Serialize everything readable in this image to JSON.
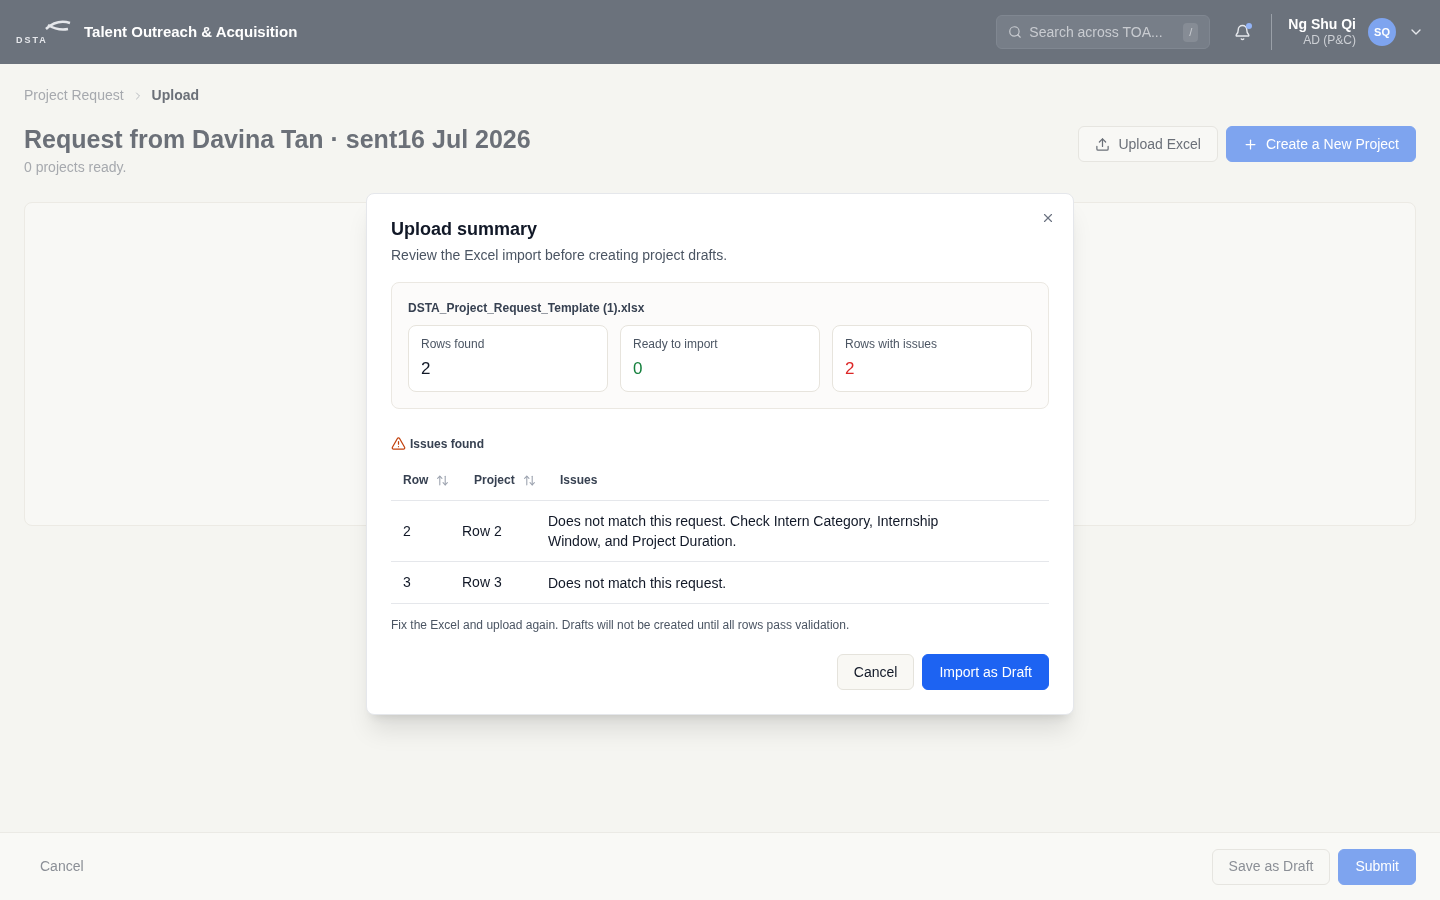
{
  "header": {
    "logo_text": "DSTA",
    "app_title": "Talent Outreach & Acquisition",
    "search": {
      "placeholder": "Search across TOA...",
      "shortcut": "/"
    },
    "notifications": {
      "unread": true
    },
    "user": {
      "name": "Ng Shu Qi",
      "role": "AD (P&C)",
      "initials": "SQ"
    }
  },
  "breadcrumbs": [
    {
      "label": "Project Request",
      "current": false
    },
    {
      "label": "Upload",
      "current": true
    }
  ],
  "page": {
    "title": "Request from Davina Tan · sent16 Jul 2026",
    "subtitle": "0 projects ready.",
    "actions": [
      {
        "label": "Upload Excel",
        "kind": "upload"
      },
      {
        "label": "Create a New Project",
        "kind": "primary"
      }
    ]
  },
  "footer": {
    "cancel": "Cancel",
    "buttons": [
      {
        "label": "Save as Draft",
        "kind": "secondary"
      },
      {
        "label": "Submit",
        "kind": "primary"
      }
    ]
  },
  "dialog": {
    "title": "Upload summary",
    "description": "Review the Excel import before creating project drafts.",
    "file_name": "DSTA_Project_Request_Template (1).xlsx",
    "stats": [
      {
        "label": "Rows found",
        "value": "2",
        "color": "#111827"
      },
      {
        "label": "Ready to import",
        "value": "0",
        "color": "#15803d"
      },
      {
        "label": "Rows with issues",
        "value": "2",
        "color": "#dc2626"
      }
    ],
    "issues_heading": "Issues found",
    "table": {
      "columns": [
        {
          "label": "Row",
          "sortable": true
        },
        {
          "label": "Project",
          "sortable": true
        },
        {
          "label": "Issues",
          "sortable": false
        }
      ],
      "rows": [
        {
          "row": "2",
          "project": "Row 2",
          "issues": "Does not match this request. Check Intern Category, Internship Window, and Project Duration."
        },
        {
          "row": "3",
          "project": "Row 3",
          "issues": "Does not match this request."
        }
      ]
    },
    "note": "Fix the Excel and upload again. Drafts will not be created until all rows pass validation.",
    "buttons": [
      {
        "label": "Cancel",
        "kind": "secondary"
      },
      {
        "label": "Import as Draft",
        "kind": "primary"
      }
    ]
  }
}
